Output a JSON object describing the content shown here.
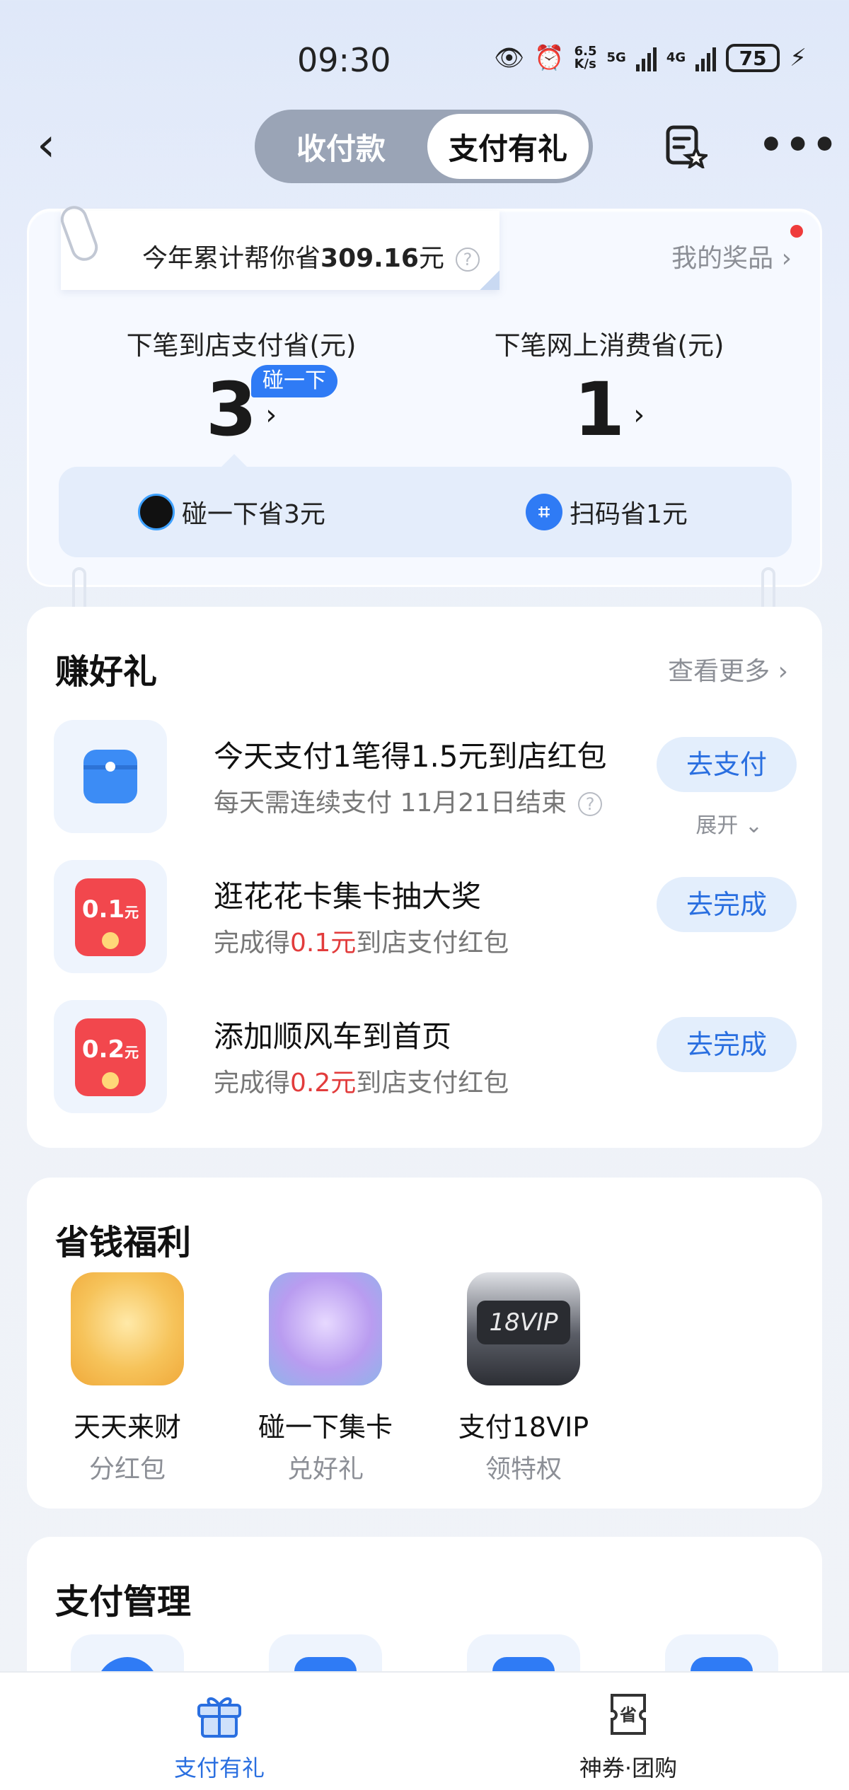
{
  "status_bar": {
    "time": "09:30",
    "net_speed_top": "6.5",
    "net_speed_bottom": "K/s",
    "sig1": "5G",
    "sig2": "4G",
    "battery": "75"
  },
  "header": {
    "tabs": [
      {
        "label": "收付款",
        "active": false
      },
      {
        "label": "支付有礼",
        "active": true
      }
    ]
  },
  "savings": {
    "total_prefix": "今年累计帮你省",
    "total_amount": "309.16",
    "total_suffix": "元",
    "help": "?",
    "my_prizes": "我的奖品 ›",
    "store_label": "下笔到店支付省(元)",
    "store_value": "3",
    "store_tag": "碰一下",
    "online_label": "下笔网上消费省(元)",
    "online_value": "1",
    "arrow": "›",
    "methods": [
      {
        "label": "碰一下省3元"
      },
      {
        "label": "扫码省1元"
      }
    ]
  },
  "earn": {
    "title": "赚好礼",
    "see_more": "查看更多 ›",
    "tasks": [
      {
        "title": "今天支付1笔得1.5元到店红包",
        "sub": "每天需连续支付 11月21日结束",
        "button": "去支付",
        "expand": "展开 ⌄"
      },
      {
        "title": "逛花花卡集卡抽大奖",
        "sub_pre": "完成得",
        "sub_amt": "0.1元",
        "sub_post": "到店支付红包",
        "button": "去完成",
        "badge_amt": "0.1",
        "badge_unit": "元"
      },
      {
        "title": "添加顺风车到首页",
        "sub_pre": "完成得",
        "sub_amt": "0.2元",
        "sub_post": "到店支付红包",
        "button": "去完成",
        "badge_amt": "0.2",
        "badge_unit": "元"
      }
    ]
  },
  "welfare": {
    "title": "省钱福利",
    "items": [
      {
        "name": "天天来财",
        "sub": "分红包"
      },
      {
        "name": "碰一下集卡",
        "sub": "兑好礼"
      },
      {
        "name": "支付18VIP",
        "sub": "领特权",
        "badge": "18VIP"
      }
    ]
  },
  "payment_mgmt": {
    "title": "支付管理"
  },
  "tabbar": {
    "items": [
      {
        "label": "支付有礼",
        "active": true
      },
      {
        "label": "神券·团购",
        "active": false,
        "badge": "省"
      }
    ]
  },
  "colors": {
    "accent": "#2a6fe0",
    "red": "#e23c3c",
    "envelope": "#f2474d"
  }
}
